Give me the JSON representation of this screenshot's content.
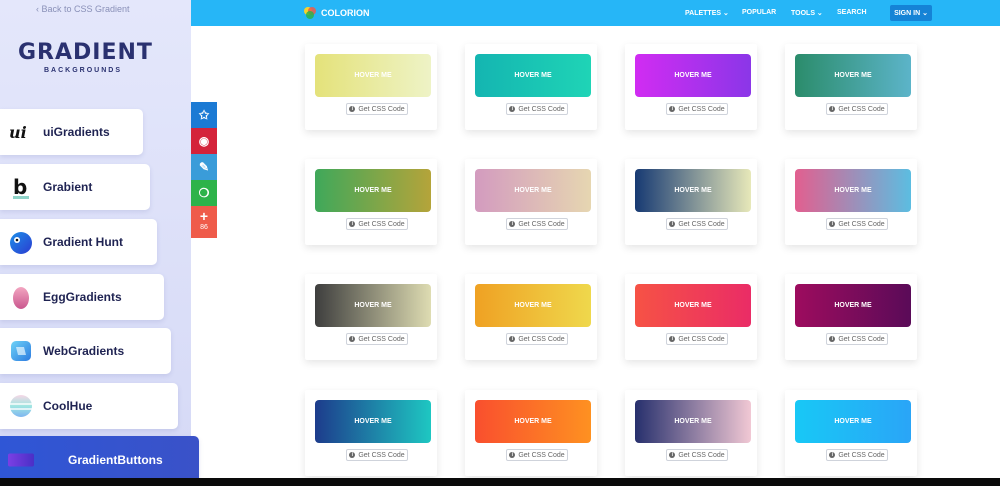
{
  "sidebar": {
    "back_link": "‹ Back to CSS Gradient",
    "logo_title": "GRADIENT",
    "logo_subtitle": "BACKGROUNDS",
    "items": [
      {
        "label": "uiGradients",
        "icon": "ui-logo-icon"
      },
      {
        "label": "Grabient",
        "icon": "grabient-logo-icon"
      },
      {
        "label": "Gradient Hunt",
        "icon": "gradient-hunt-bird-icon"
      },
      {
        "label": "EggGradients",
        "icon": "egg-icon"
      },
      {
        "label": "WebGradients",
        "icon": "webgradients-cube-icon"
      },
      {
        "label": "CoolHue",
        "icon": "coolhue-disc-icon"
      },
      {
        "label": "GradientButtons",
        "icon": "gradient-bar-icon"
      }
    ]
  },
  "share": {
    "count": "86",
    "colors": [
      "#1b7ad4",
      "#d4233a",
      "#3a9cd9",
      "#2db34a",
      "#ef5b4a"
    ]
  },
  "topbar": {
    "brand": "COLORION",
    "nav": [
      "PALETTES ⌄",
      "POPULAR",
      "TOOLS ⌄",
      "SEARCH"
    ],
    "signin": "SIGN IN ⌄",
    "color": "#26b6f7"
  },
  "card_text": {
    "hover": "HOVER ME",
    "css_button": "Get CSS Code"
  },
  "gradients": [
    [
      "#e4e27a",
      "#eef3c6"
    ],
    [
      "#14b5b1",
      "#1fd4b6"
    ],
    [
      "#d12cf2",
      "#8b36e8"
    ],
    [
      "#2b8c6b",
      "#5cb4c9"
    ],
    [
      "#3fa85a",
      "#b5a43a"
    ],
    [
      "#d39bbf",
      "#e6d6b1"
    ],
    [
      "#173a73",
      "#e7e8b9"
    ],
    [
      "#e25f8f",
      "#5cbde1"
    ],
    [
      "#3e3e3e",
      "#dedcb2"
    ],
    [
      "#efa123",
      "#efd84c"
    ],
    [
      "#f65245",
      "#ea2c66"
    ],
    [
      "#9d0c5e",
      "#5a0b58"
    ],
    [
      "#1d3c8c",
      "#1ec7c2"
    ],
    [
      "#f94f2e",
      "#fe9121"
    ],
    [
      "#27306d",
      "#f1c8d4"
    ],
    [
      "#18c8f6",
      "#2aa5f7"
    ]
  ]
}
